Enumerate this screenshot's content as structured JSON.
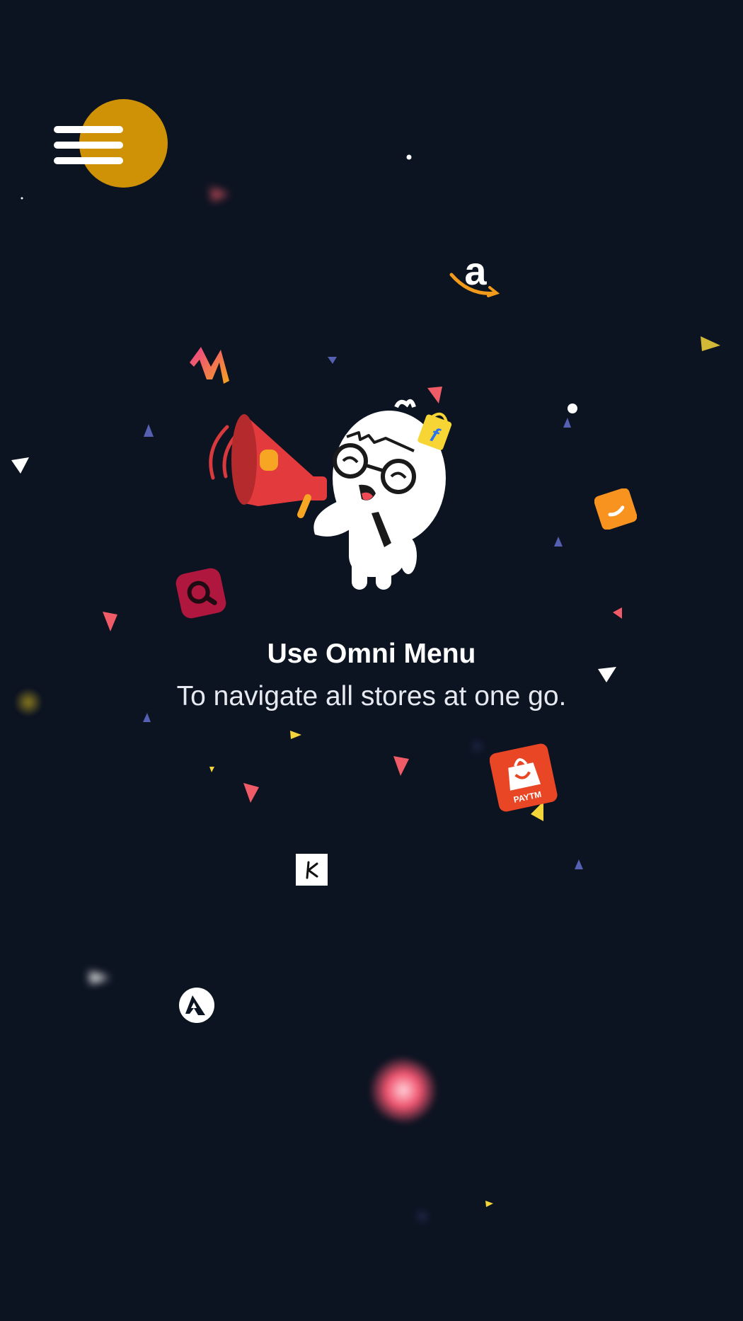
{
  "menu": {
    "icon": "hamburger-menu-icon",
    "accent": "#cf9207"
  },
  "onboarding": {
    "title": "Use Omni Menu",
    "subtitle": "To navigate all stores at one go."
  },
  "mascot": {
    "icon": "mascot-with-megaphone-icon"
  },
  "store_icons": [
    "amazon-logo-icon",
    "myntra-logo-icon",
    "flipkart-logo-icon",
    "shopclues-logo-icon",
    "search-app-icon",
    "paytm-logo-icon",
    "koovs-logo-icon",
    "ajio-logo-icon"
  ],
  "paytm": {
    "label": "PAYTM"
  },
  "colors": {
    "background": "#0c1321",
    "confetti_red": "#ef5b66",
    "confetti_blue": "#5560b2",
    "confetti_yellow": "#f5d63a",
    "confetti_white": "#ffffff"
  }
}
